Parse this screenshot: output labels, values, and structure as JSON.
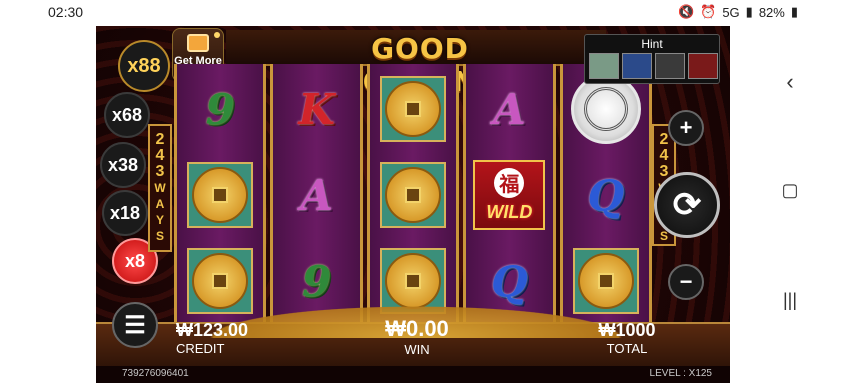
{
  "status_bar": {
    "time": "02:30",
    "battery": "82%",
    "network": "5G"
  },
  "game": {
    "title": "GOOD FORTUNE",
    "get_more": "Get More",
    "hint_label": "Hint",
    "multipliers": [
      "x88",
      "x68",
      "x38",
      "x18",
      "x8"
    ],
    "ways_label": "243 WAYS",
    "reels": [
      [
        "9",
        "coin",
        "coin"
      ],
      [
        "K",
        "A",
        "9"
      ],
      [
        "coin",
        "coin",
        "coin"
      ],
      [
        "A",
        "WILD",
        "Q"
      ],
      [
        "medal",
        "Q",
        "coin"
      ]
    ],
    "wild_label": "WILD",
    "wild_char": "福",
    "credit": {
      "value": "₩123.00",
      "label": "CREDIT"
    },
    "win": {
      "value": "₩0.00",
      "label": "WIN"
    },
    "total": {
      "value": "₩1000",
      "label": "TOTAL"
    },
    "round_id": "739276096401",
    "level": "LEVEL : X125"
  },
  "colors": {
    "accent_gold": "#f6c445",
    "reel_purple": "#6a1a63",
    "active_red": "#c10b0b"
  },
  "icons": [
    "mute-icon",
    "alarm-icon",
    "wifi-icon",
    "battery-icon",
    "back-nav-icon",
    "home-nav-icon",
    "recents-nav-icon"
  ]
}
